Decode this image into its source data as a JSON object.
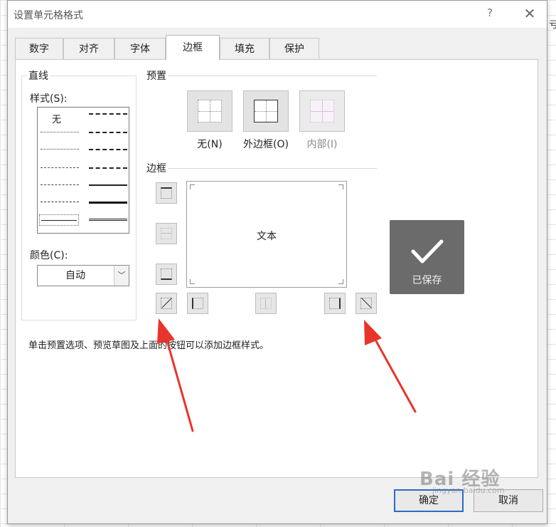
{
  "dialog": {
    "title": "设置单元格格式",
    "help_label": "?",
    "close_label": "✕"
  },
  "sheet": {
    "edge_text": "亏"
  },
  "tabs": [
    {
      "label": "数字",
      "active": false
    },
    {
      "label": "对齐",
      "active": false
    },
    {
      "label": "字体",
      "active": false
    },
    {
      "label": "边框",
      "active": true
    },
    {
      "label": "填充",
      "active": false
    },
    {
      "label": "保护",
      "active": false
    }
  ],
  "line_group": {
    "title": "直线",
    "style_label": "样式(S):",
    "none_label": "无",
    "color_label": "颜色(C):",
    "color_value": "自动"
  },
  "presets": {
    "title": "预置",
    "none_label": "无(N)",
    "outline_label": "外边框(O)",
    "inside_label": "内部(I)"
  },
  "border": {
    "title": "边框",
    "preview_text": "文本"
  },
  "hint": "单击预置选项、预览草图及上面的按钮可以添加边框样式。",
  "buttons": {
    "ok": "确定",
    "cancel": "取消"
  },
  "toast": {
    "label": "已保存"
  },
  "watermark": {
    "main": "Bai 经验",
    "sub": "jingyan.baidu.com"
  },
  "colors": {
    "accent": "#2b6cc4",
    "arrow": "#e8352b",
    "toast_bg": "#6b6b6b"
  },
  "icons": [
    "help-icon",
    "close-icon",
    "chevron-down-icon",
    "checkmark-icon",
    "paw-icon"
  ]
}
